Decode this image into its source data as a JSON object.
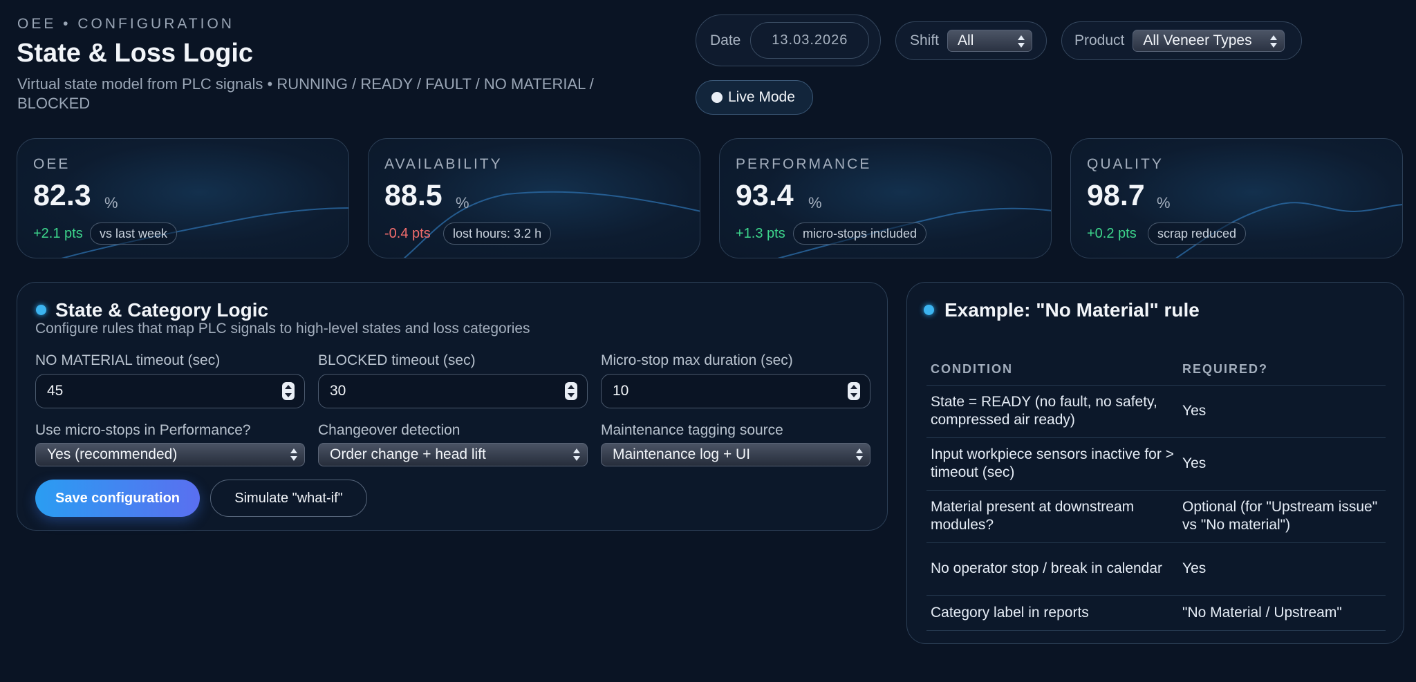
{
  "header": {
    "eyebrow": "OEE • CONFIGURATION",
    "title": "State & Loss Logic",
    "subtitle": "Virtual state model from PLC signals • RUNNING / READY / FAULT / NO MATERIAL / BLOCKED"
  },
  "filters": {
    "date_label": "Date",
    "date_value": "13.03.2026",
    "shift_label": "Shift",
    "shift_value": "All",
    "product_label": "Product",
    "product_value": "All Veneer Types",
    "live_mode_label": "Live Mode"
  },
  "kpis": [
    {
      "label": "OEE",
      "value": "82.3",
      "unit": "%",
      "delta": "+2.1 pts",
      "trend": "up",
      "note": "vs last week"
    },
    {
      "label": "AVAILABILITY",
      "value": "88.5",
      "unit": "%",
      "delta": "-0.4 pts",
      "trend": "down",
      "note": "lost hours: 3.2 h"
    },
    {
      "label": "PERFORMANCE",
      "value": "93.4",
      "unit": "%",
      "delta": "+1.3 pts",
      "trend": "up",
      "note": "micro-stops included"
    },
    {
      "label": "QUALITY",
      "value": "98.7",
      "unit": "%",
      "delta": "+0.2 pts",
      "trend": "up",
      "note": "scrap reduced"
    }
  ],
  "config": {
    "title": "State & Category Logic",
    "description": "Configure rules that map PLC signals to high-level states and loss categories",
    "fields": {
      "no_material_timeout": {
        "label": "NO MATERIAL timeout (sec)",
        "value": "45"
      },
      "blocked_timeout": {
        "label": "BLOCKED timeout (sec)",
        "value": "30"
      },
      "micro_stop_max": {
        "label": "Micro-stop max duration (sec)",
        "value": "10"
      },
      "use_micro_stops": {
        "label": "Use micro-stops in Performance?",
        "value": "Yes (recommended)"
      },
      "changeover_detection": {
        "label": "Changeover detection",
        "value": "Order change + head lift"
      },
      "maintenance_source": {
        "label": "Maintenance tagging source",
        "value": "Maintenance log + UI"
      }
    },
    "save_label": "Save configuration",
    "simulate_label": "Simulate \"what-if\""
  },
  "rule": {
    "title": "Example: \"No Material\" rule",
    "columns": [
      "CONDITION",
      "REQUIRED?"
    ],
    "rows": [
      {
        "condition": "State = READY (no fault, no safety, compressed air ready)",
        "required": "Yes"
      },
      {
        "condition": "Input workpiece sensors inactive for > timeout (sec)",
        "required": "Yes"
      },
      {
        "condition": "Material present at downstream modules?",
        "required": "Optional (for \"Upstream issue\" vs \"No material\")"
      },
      {
        "condition": "No operator stop / break in calendar",
        "required": "Yes"
      },
      {
        "condition": "Category label in reports",
        "required": "\"No Material / Upstream\""
      }
    ]
  },
  "colors": {
    "background": "#0a1424",
    "accent": "#3cb4f0",
    "positive": "#3dd68c",
    "negative": "#f26d6d"
  }
}
